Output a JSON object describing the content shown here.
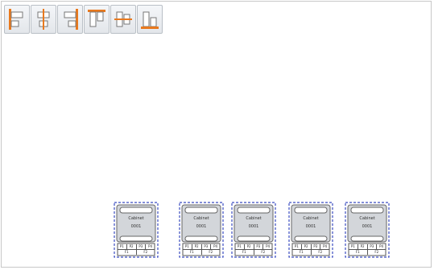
{
  "toolbar": {
    "accent": "#e8791e",
    "buttons": [
      {
        "name": "align-left-button",
        "icon": "align-left-icon"
      },
      {
        "name": "align-center-horizontal-button",
        "icon": "align-center-horizontal-icon"
      },
      {
        "name": "align-right-button",
        "icon": "align-right-icon"
      },
      {
        "name": "align-top-button",
        "icon": "align-top-icon"
      },
      {
        "name": "align-middle-vertical-button",
        "icon": "align-middle-vertical-icon"
      },
      {
        "name": "align-bottom-button",
        "icon": "align-bottom-icon"
      }
    ]
  },
  "cabinets": [
    {
      "name": "Cabinet",
      "code": "0001",
      "ports": [
        "P1",
        "P2",
        "P3",
        "P4"
      ],
      "feeds": [
        "F1",
        "F2"
      ]
    },
    {
      "name": "Cabinet",
      "code": "0001",
      "ports": [
        "P1",
        "P2",
        "P3",
        "P4"
      ],
      "feeds": [
        "F1",
        "F2"
      ]
    },
    {
      "name": "Cabinet",
      "code": "0001",
      "ports": [
        "P1",
        "P2",
        "P3",
        "P4"
      ],
      "feeds": [
        "F1",
        "F2"
      ]
    },
    {
      "name": "Cabinet",
      "code": "0001",
      "ports": [
        "P1",
        "P2",
        "P3",
        "P4"
      ],
      "feeds": [
        "F1",
        "F2"
      ]
    },
    {
      "name": "Cabinet",
      "code": "0001",
      "ports": [
        "P1",
        "P2",
        "P3",
        "P4"
      ],
      "feeds": [
        "F1",
        "F2"
      ]
    }
  ],
  "selection_color": "#3b4cc0"
}
